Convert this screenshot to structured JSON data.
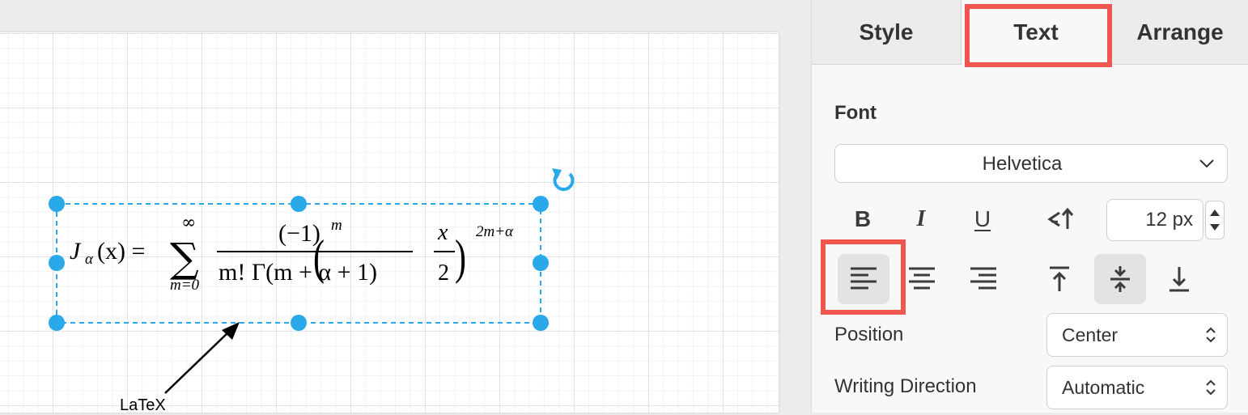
{
  "canvas": {
    "shape_label": "LaTeX",
    "formula": {
      "lhs": "J",
      "lhs_sub": "α",
      "lhs_arg": "(x) =",
      "sum_top": "∞",
      "sum_symbol": "∑",
      "sum_bottom": "m=0",
      "numerator": "(−1)",
      "numerator_exp": "m",
      "denominator": "m! Γ(m + α + 1)",
      "paren_num": "x",
      "paren_den": "2",
      "outer_exp": "2m+α"
    },
    "selection_color": "#29a8ea"
  },
  "panel": {
    "tabs": [
      "Style",
      "Text",
      "Arrange"
    ],
    "active_tab": "Text",
    "font_section": "Font",
    "font_family": "Helvetica",
    "font_size": "12 px",
    "format_buttons": {
      "bold": "B",
      "italic": "I",
      "underline": "U"
    },
    "position_label": "Position",
    "position_value": "Center",
    "writing_direction_label": "Writing Direction",
    "writing_direction_value": "Automatic"
  },
  "colors": {
    "highlight": "#f0564e",
    "selection": "#29a8ea"
  }
}
